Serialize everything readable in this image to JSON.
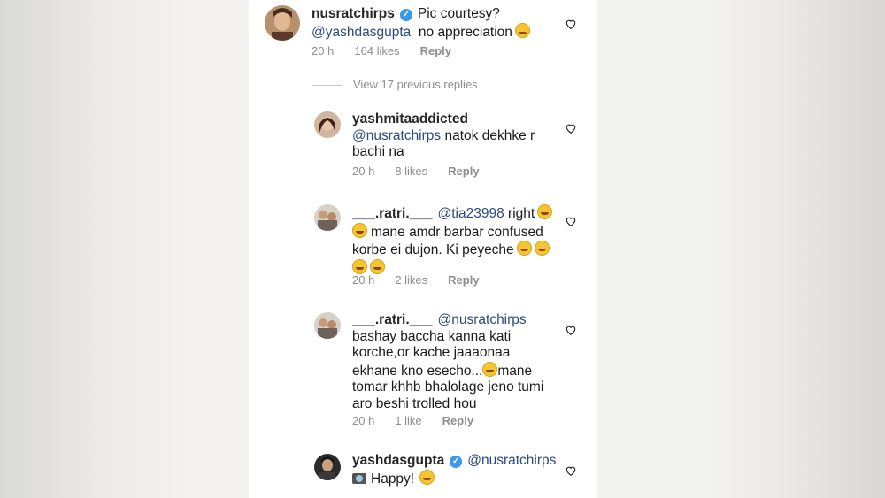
{
  "comments": [
    {
      "username": "nusratchirps",
      "verified": true,
      "text_1": "Pic courtesy?",
      "mention": "@yashdasgupta",
      "text_2": "no appreciation",
      "time": "20 h",
      "likes": "164 likes",
      "reply": "Reply"
    }
  ],
  "view_replies": "View 17 previous replies",
  "replies": [
    {
      "username": "yashmitaaddicted",
      "mention": "@nusratchirps",
      "text": "natok dekhke r",
      "text_line2": "bachi na",
      "time": "20 h",
      "likes": "8 likes",
      "reply": "Reply"
    },
    {
      "username": "___.ratri.___",
      "mention": "@tia23998",
      "text": "right",
      "text_line2": "mane amdr barbar confused",
      "text_line3": "korbe ei dujon. Ki peyeche",
      "time": "20 h",
      "likes": "2 likes",
      "reply": "Reply"
    },
    {
      "username": "___.ratri.___",
      "mention": "@nusratchirps",
      "text_line1": "bashay baccha kanna kati",
      "text_line2": "korche,or kache jaaaonaa",
      "text_line3": "ekhane kno esecho...",
      "text_line3b": "mane",
      "text_line4": "tomar khhb bhalolage jeno tumi",
      "text_line5": "aro beshi trolled hou",
      "time": "20 h",
      "likes": "1 like",
      "reply": "Reply"
    },
    {
      "username": "yashdasgupta",
      "verified": true,
      "mention": "@nusratchirps",
      "text": "Happy!"
    }
  ],
  "icons": {
    "heart": "heart-outline-icon",
    "verified": "verified-badge-icon",
    "emoji": "emoji-icon"
  },
  "colors": {
    "mention": "#2c4a7a",
    "meta": "#8e8e8e",
    "verified": "#3897f0"
  }
}
